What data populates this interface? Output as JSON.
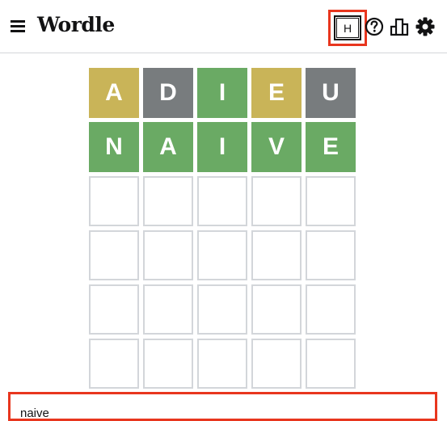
{
  "header": {
    "title": "Wordle",
    "hint_label": "H",
    "icons": [
      "menu-icon",
      "help-icon",
      "stats-icon",
      "settings-icon"
    ]
  },
  "board": {
    "rows": [
      [
        {
          "letter": "A",
          "state": "present"
        },
        {
          "letter": "D",
          "state": "absent"
        },
        {
          "letter": "I",
          "state": "correct"
        },
        {
          "letter": "E",
          "state": "present"
        },
        {
          "letter": "U",
          "state": "absent"
        }
      ],
      [
        {
          "letter": "N",
          "state": "correct"
        },
        {
          "letter": "A",
          "state": "correct"
        },
        {
          "letter": "I",
          "state": "correct"
        },
        {
          "letter": "V",
          "state": "correct"
        },
        {
          "letter": "E",
          "state": "correct"
        }
      ],
      [
        {
          "letter": "",
          "state": "empty"
        },
        {
          "letter": "",
          "state": "empty"
        },
        {
          "letter": "",
          "state": "empty"
        },
        {
          "letter": "",
          "state": "empty"
        },
        {
          "letter": "",
          "state": "empty"
        }
      ],
      [
        {
          "letter": "",
          "state": "empty"
        },
        {
          "letter": "",
          "state": "empty"
        },
        {
          "letter": "",
          "state": "empty"
        },
        {
          "letter": "",
          "state": "empty"
        },
        {
          "letter": "",
          "state": "empty"
        }
      ],
      [
        {
          "letter": "",
          "state": "empty"
        },
        {
          "letter": "",
          "state": "empty"
        },
        {
          "letter": "",
          "state": "empty"
        },
        {
          "letter": "",
          "state": "empty"
        },
        {
          "letter": "",
          "state": "empty"
        }
      ],
      [
        {
          "letter": "",
          "state": "empty"
        },
        {
          "letter": "",
          "state": "empty"
        },
        {
          "letter": "",
          "state": "empty"
        },
        {
          "letter": "",
          "state": "empty"
        },
        {
          "letter": "",
          "state": "empty"
        }
      ]
    ]
  },
  "input": {
    "value": "naive"
  },
  "colors": {
    "correct": "#6aaa64",
    "present": "#c9b458",
    "absent": "#787c7e",
    "highlight": "#e8361e"
  }
}
